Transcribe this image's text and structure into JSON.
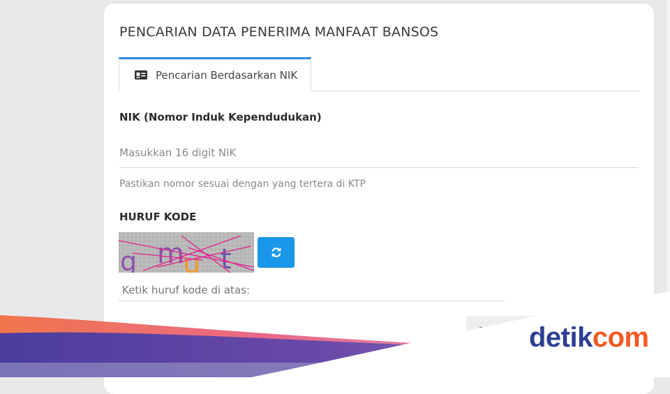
{
  "page": {
    "title": "PENCARIAN DATA PENERIMA MANFAAT BANSOS"
  },
  "tab": {
    "label": "Pencarian Berdasarkan NIK",
    "icon": "id-card-icon"
  },
  "nik": {
    "label": "NIK (Nomor Induk Kependudukan)",
    "placeholder": "Masukkan 16 digit NIK",
    "value": "",
    "hint": "Pastikan nomor sesuai dengan yang tertera di KTP"
  },
  "captcha": {
    "label": "HURUF KODE",
    "code": "gmut",
    "refresh_icon": "refresh-icon",
    "input_placeholder": "Ketik huruf kode di atas:",
    "input_value": ""
  },
  "submit": {
    "label": "BAT"
  },
  "watermark": {
    "part1": "detik",
    "part2": "com"
  },
  "colors": {
    "accent": "#2f87d4",
    "refresh_button": "#1a97e8",
    "brand_blue": "#2d3f93",
    "brand_orange": "#f15a24"
  }
}
